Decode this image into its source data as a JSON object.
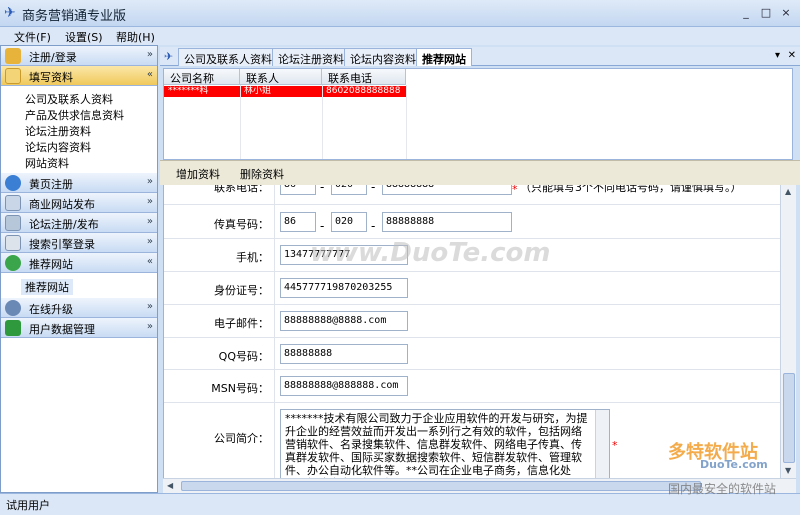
{
  "window": {
    "title": "商务营销通专业版",
    "buttons": [
      "_",
      "□",
      "×"
    ]
  },
  "menu": {
    "items": [
      "文件(F)",
      "设置(S)",
      "帮助(H)"
    ]
  },
  "sidebar": {
    "sections": [
      {
        "label": "注册/登录",
        "icon": "key-icon"
      },
      {
        "label": "填写资料",
        "icon": "folder-icon",
        "expanded": true,
        "items": [
          "公司及联系人资料",
          "产品及供求信息资料",
          "论坛注册资料",
          "论坛内容资料",
          "网站资料"
        ]
      },
      {
        "label": "黄页注册",
        "icon": "globe-icon"
      },
      {
        "label": "商业网站发布",
        "icon": "book-icon"
      },
      {
        "label": "论坛注册/发布",
        "icon": "tools-icon"
      },
      {
        "label": "搜索引擎登录",
        "icon": "search-engine-icon"
      },
      {
        "label": "推荐网站",
        "icon": "check-icon",
        "expanded": true,
        "items": [
          "推荐网站"
        ]
      },
      {
        "label": "在线升级",
        "icon": "user-icon"
      },
      {
        "label": "用户数据管理",
        "icon": "disk-icon"
      }
    ]
  },
  "tabs": {
    "items": [
      "公司及联系人资料",
      "论坛注册资料",
      "论坛内容资料",
      "推荐网站"
    ],
    "active": 3
  },
  "grid": {
    "columns": [
      "公司名称",
      "联系人",
      "联系电话"
    ],
    "rows": [
      [
        "*******科",
        "林小姐",
        "8602088888888"
      ]
    ]
  },
  "toolbar": {
    "add": "增加资料",
    "delete": "删除资料"
  },
  "form": {
    "phone": {
      "label": "联系电话：",
      "country": "86",
      "area": "020",
      "number": "88888888",
      "hint": "（只能填写3个不同电话号码，请谨慎填写。）"
    },
    "fax": {
      "label": "传真号码：",
      "country": "86",
      "area": "020",
      "number": "88888888"
    },
    "mobile": {
      "label": "手机：",
      "value": "13477777777"
    },
    "idcard": {
      "label": "身份证号：",
      "value": "445777719870203255"
    },
    "email": {
      "label": "电子邮件：",
      "value": "88888888@8888.com"
    },
    "qq": {
      "label": "QQ号码：",
      "value": "88888888"
    },
    "msn": {
      "label": "MSN号码：",
      "value": "88888888@888888.com"
    },
    "intro": {
      "label": "公司简介：",
      "value": "    *******技术有限公司致力于企业应用软件的开发与研究，为提升企业的经营效益而开发出一系列行之有效的软件，包括网络营销软件、名录搜集软件、信息群发软件、网络电子传真、传真群发软件、国际买家数据搜索软件、短信群发软件、管理软件、办公自动化软件等。**公司在企业电子商务，信息化处理，解决方案已经走得更远"
    }
  },
  "status": {
    "text": "试用用户"
  },
  "watermark": {
    "center": "www.DuoTe.com",
    "logo": "多特软件站",
    "domain": "DuoTe.com",
    "slogan": "国内最安全的软件站"
  }
}
